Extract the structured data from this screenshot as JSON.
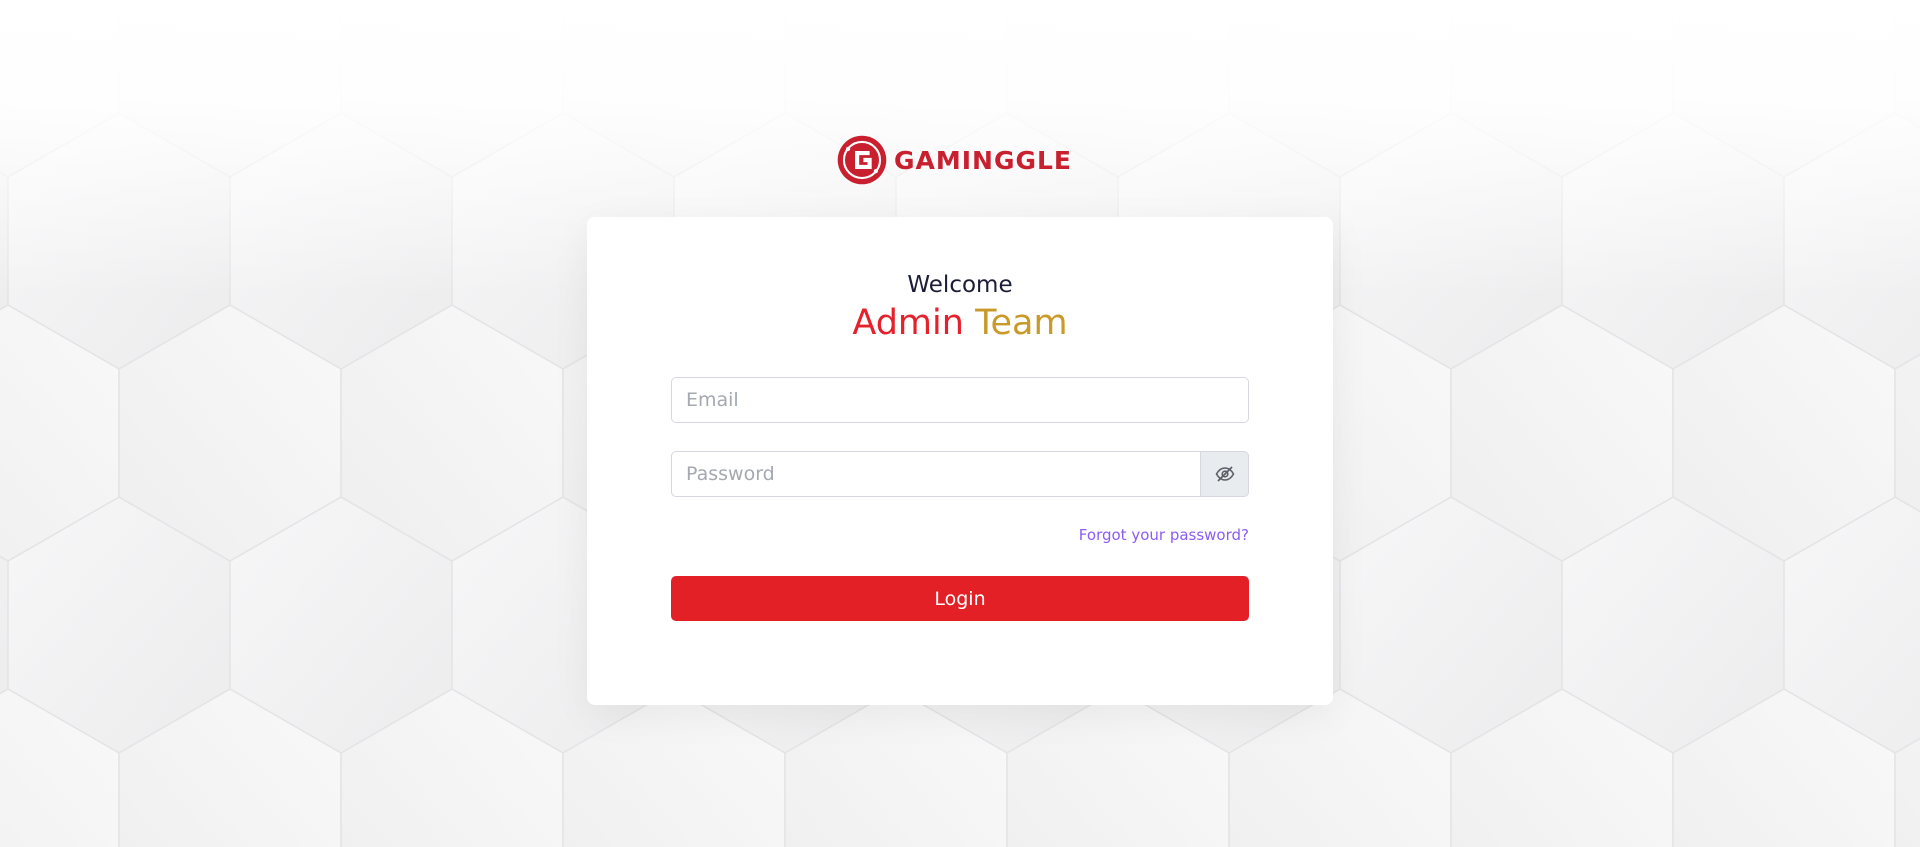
{
  "brand": {
    "name": "GAMINGGLE",
    "logo_letter": "G",
    "color": "#c8202e",
    "logo_icon": "gaminggle-logo-icon"
  },
  "login_card": {
    "welcome": "Welcome",
    "title_first": "Admin",
    "title_second": "Team",
    "title_first_color": "#e4212c",
    "title_second_color": "#c99a29",
    "email": {
      "placeholder": "Email",
      "value": ""
    },
    "password": {
      "placeholder": "Password",
      "value": "",
      "toggle_icon": "eye-slash-icon"
    },
    "forgot_password": "Forgot your password?",
    "login_button": "Login",
    "login_button_color": "#e32026",
    "link_color": "#8d5cf6"
  }
}
